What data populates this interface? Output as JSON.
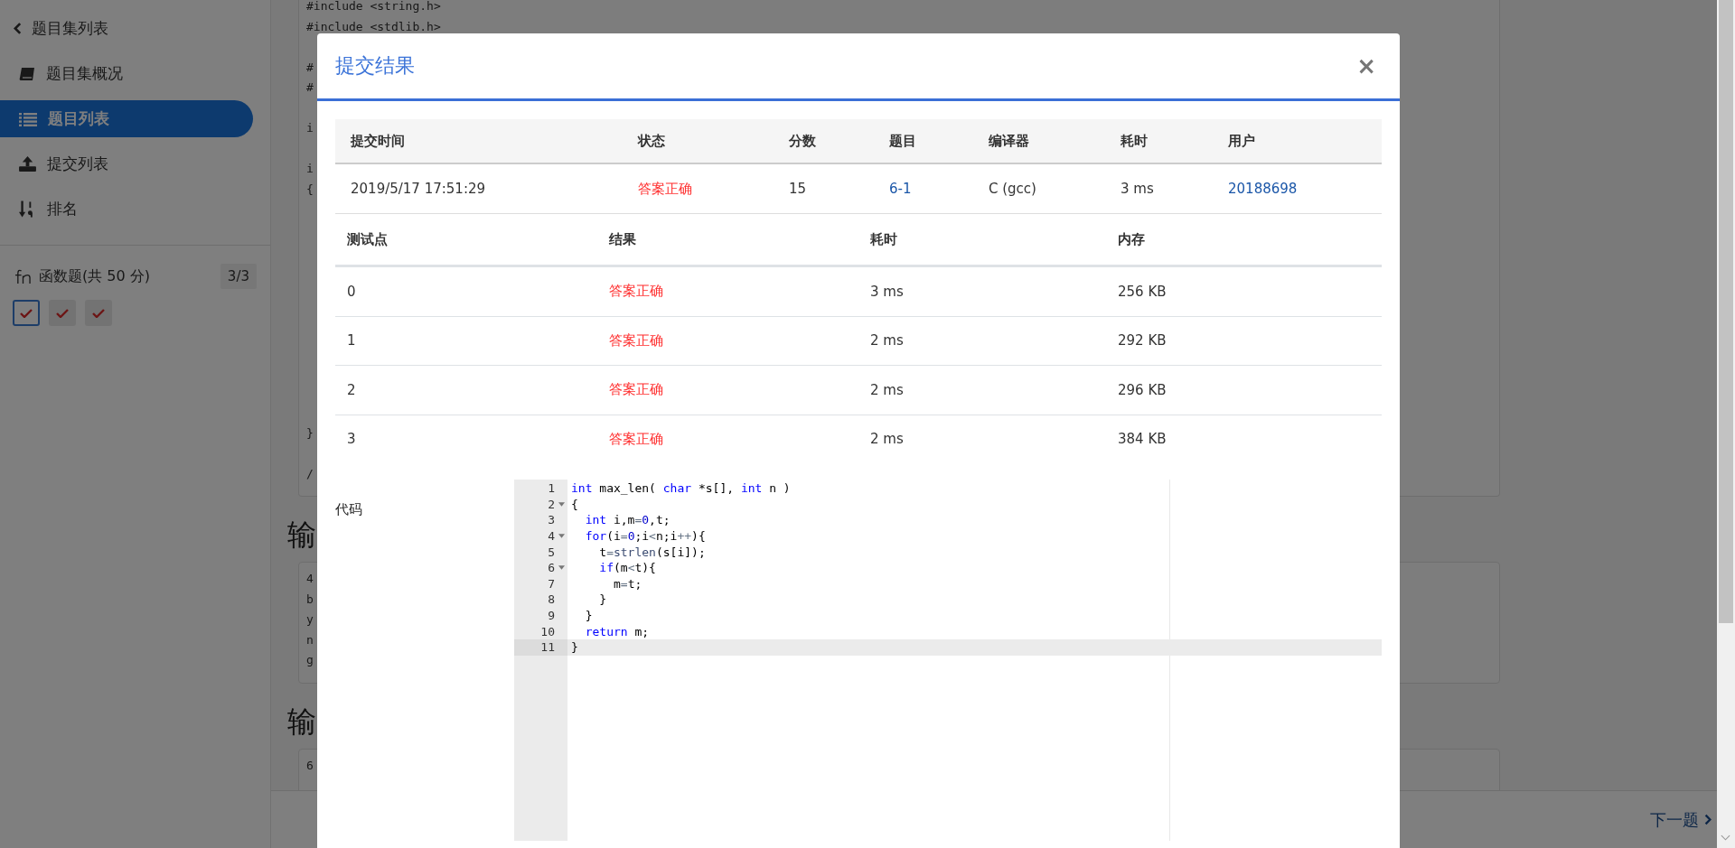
{
  "sidebar": {
    "back_link": "题目集列表",
    "items": [
      {
        "label": "题目集概况",
        "selected": false
      },
      {
        "label": "题目列表",
        "selected": true
      },
      {
        "label": "提交列表",
        "selected": false
      },
      {
        "label": "排名",
        "selected": false
      }
    ],
    "section": {
      "title": "函数题(共 50 分)",
      "badge": "3/3",
      "problems": [
        {
          "selected": true,
          "passed": true
        },
        {
          "selected": false,
          "passed": true
        },
        {
          "selected": false,
          "passed": true
        }
      ]
    }
  },
  "page": {
    "code_lines": [
      "#include <string.h>",
      "#include <stdlib.h>",
      "#",
      "#",
      "i",
      "i",
      "{",
      "}",
      "/"
    ],
    "headings": [
      "输",
      "输"
    ],
    "sample_lines": [
      "4",
      "b",
      "y",
      "n",
      "g"
    ],
    "sample2_lines": [
      "6"
    ],
    "next_link": "下一题"
  },
  "modal": {
    "title": "提交结果",
    "close": "×",
    "submission": {
      "columns": [
        "提交时间",
        "状态",
        "分数",
        "题目",
        "编译器",
        "耗时",
        "用户"
      ],
      "row": [
        {
          "text": "2019/5/17 17:51:29",
          "kind": "text"
        },
        {
          "text": "答案正确",
          "kind": "status"
        },
        {
          "text": "15",
          "kind": "text"
        },
        {
          "text": "6-1",
          "kind": "link"
        },
        {
          "text": "C (gcc)",
          "kind": "text"
        },
        {
          "text": "3 ms",
          "kind": "text"
        },
        {
          "text": "20188698",
          "kind": "link"
        }
      ]
    },
    "tests": {
      "columns": [
        "测试点",
        "结果",
        "耗时",
        "内存"
      ],
      "rows": [
        [
          {
            "text": "0",
            "kind": "text"
          },
          {
            "text": "答案正确",
            "kind": "status"
          },
          {
            "text": "3 ms",
            "kind": "text"
          },
          {
            "text": "256 KB",
            "kind": "text"
          }
        ],
        [
          {
            "text": "1",
            "kind": "text"
          },
          {
            "text": "答案正确",
            "kind": "status"
          },
          {
            "text": "2 ms",
            "kind": "text"
          },
          {
            "text": "292 KB",
            "kind": "text"
          }
        ],
        [
          {
            "text": "2",
            "kind": "text"
          },
          {
            "text": "答案正确",
            "kind": "status"
          },
          {
            "text": "2 ms",
            "kind": "text"
          },
          {
            "text": "296 KB",
            "kind": "text"
          }
        ],
        [
          {
            "text": "3",
            "kind": "text"
          },
          {
            "text": "答案正确",
            "kind": "status"
          },
          {
            "text": "2 ms",
            "kind": "text"
          },
          {
            "text": "384 KB",
            "kind": "text"
          }
        ]
      ]
    },
    "code_label": "代码",
    "code": [
      {
        "number": "1",
        "foldable": false,
        "active": false,
        "tokens": [
          {
            "text": "int",
            "kind": "keyword"
          },
          {
            "text": " max_len( ",
            "kind": "plain"
          },
          {
            "text": "char",
            "kind": "keyword"
          },
          {
            "text": " *s[], ",
            "kind": "plain"
          },
          {
            "text": "int",
            "kind": "keyword"
          },
          {
            "text": " n )",
            "kind": "plain"
          }
        ]
      },
      {
        "number": "2",
        "foldable": true,
        "active": false,
        "tokens": [
          {
            "text": "{",
            "kind": "plain"
          }
        ]
      },
      {
        "number": "3",
        "foldable": false,
        "active": false,
        "tokens": [
          {
            "text": "  int",
            "kind": "keyword"
          },
          {
            "text": " i,m",
            "kind": "plain"
          },
          {
            "text": "=",
            "kind": "operator"
          },
          {
            "text": "0",
            "kind": "number"
          },
          {
            "text": ",t;",
            "kind": "plain"
          }
        ]
      },
      {
        "number": "4",
        "foldable": true,
        "active": false,
        "tokens": [
          {
            "text": "  for",
            "kind": "keyword"
          },
          {
            "text": "(i",
            "kind": "plain"
          },
          {
            "text": "=",
            "kind": "operator"
          },
          {
            "text": "0",
            "kind": "number"
          },
          {
            "text": ";i",
            "kind": "plain"
          },
          {
            "text": "<",
            "kind": "operator"
          },
          {
            "text": "n;i",
            "kind": "plain"
          },
          {
            "text": "++",
            "kind": "operator"
          },
          {
            "text": "){",
            "kind": "plain"
          }
        ]
      },
      {
        "number": "5",
        "foldable": false,
        "active": false,
        "tokens": [
          {
            "text": "    t",
            "kind": "plain"
          },
          {
            "text": "=",
            "kind": "operator"
          },
          {
            "text": "strlen",
            "kind": "function"
          },
          {
            "text": "(s[i]);",
            "kind": "plain"
          }
        ]
      },
      {
        "number": "6",
        "foldable": true,
        "active": false,
        "tokens": [
          {
            "text": "    if",
            "kind": "keyword"
          },
          {
            "text": "(m",
            "kind": "plain"
          },
          {
            "text": "<",
            "kind": "operator"
          },
          {
            "text": "t){",
            "kind": "plain"
          }
        ]
      },
      {
        "number": "7",
        "foldable": false,
        "active": false,
        "tokens": [
          {
            "text": "      m",
            "kind": "plain"
          },
          {
            "text": "=",
            "kind": "operator"
          },
          {
            "text": "t;",
            "kind": "plain"
          }
        ]
      },
      {
        "number": "8",
        "foldable": false,
        "active": false,
        "tokens": [
          {
            "text": "    }",
            "kind": "plain"
          }
        ]
      },
      {
        "number": "9",
        "foldable": false,
        "active": false,
        "tokens": [
          {
            "text": "  }",
            "kind": "plain"
          }
        ]
      },
      {
        "number": "10",
        "foldable": false,
        "active": false,
        "tokens": [
          {
            "text": "  return",
            "kind": "keyword"
          },
          {
            "text": " m;",
            "kind": "plain"
          }
        ]
      },
      {
        "number": "11",
        "foldable": false,
        "active": true,
        "tokens": [
          {
            "text": "}",
            "kind": "plain"
          }
        ]
      }
    ]
  }
}
